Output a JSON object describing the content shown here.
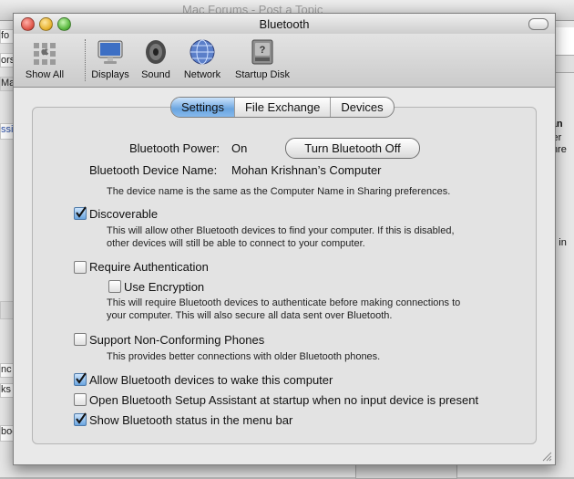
{
  "background": {
    "window_title": "Mac Forums - Post a Topic",
    "left_fragments": [
      "fo",
      "ors ▾",
      "Ma",
      "ssic",
      "ks",
      "ks",
      "nc",
      "boot"
    ],
    "right_fragments": [
      "nan",
      "ster",
      "Unre",
      "ed in"
    ]
  },
  "window": {
    "title": "Bluetooth",
    "toolbar": [
      {
        "label": "Show All",
        "icon": "apple-icon"
      },
      {
        "label": "Displays",
        "icon": "display-icon"
      },
      {
        "label": "Sound",
        "icon": "speaker-icon"
      },
      {
        "label": "Network",
        "icon": "globe-icon"
      },
      {
        "label": "Startup Disk",
        "icon": "disk-icon"
      }
    ],
    "tabs": [
      {
        "label": "Settings",
        "selected": true
      },
      {
        "label": "File Exchange",
        "selected": false
      },
      {
        "label": "Devices",
        "selected": false
      }
    ]
  },
  "settings": {
    "power_label": "Bluetooth Power:",
    "power_value": "On",
    "power_button": "Turn Bluetooth Off",
    "device_name_label": "Bluetooth Device Name:",
    "device_name_value": "Mohan Krishnan’s Computer",
    "device_name_desc": "The device name is the same as the Computer Name in Sharing preferences.",
    "discoverable": {
      "label": "Discoverable",
      "checked": true,
      "desc1": "This will allow other Bluetooth devices to find your computer.  If this is disabled,",
      "desc2": "other devices will still be able to connect to your computer."
    },
    "require_auth": {
      "label": "Require Authentication",
      "checked": false
    },
    "use_encryption": {
      "label": "Use Encryption",
      "checked": false,
      "desc1": "This will require Bluetooth devices to authenticate before making connections to",
      "desc2": "your computer. This will also secure all data sent over Bluetooth."
    },
    "non_conforming": {
      "label": "Support Non-Conforming Phones",
      "checked": false,
      "desc1": "This provides better connections with older Bluetooth phones."
    },
    "allow_wake": {
      "label": "Allow Bluetooth devices to wake this computer",
      "checked": true
    },
    "setup_assistant": {
      "label": "Open Bluetooth Setup Assistant at startup when no input device is present",
      "checked": false
    },
    "status_menu": {
      "label": "Show Bluetooth status in the menu bar",
      "checked": true
    }
  },
  "colors": {
    "accent": "#6aa5e0",
    "close": "#e25b4f",
    "minimize": "#e8b535",
    "zoom": "#5fbb45"
  }
}
